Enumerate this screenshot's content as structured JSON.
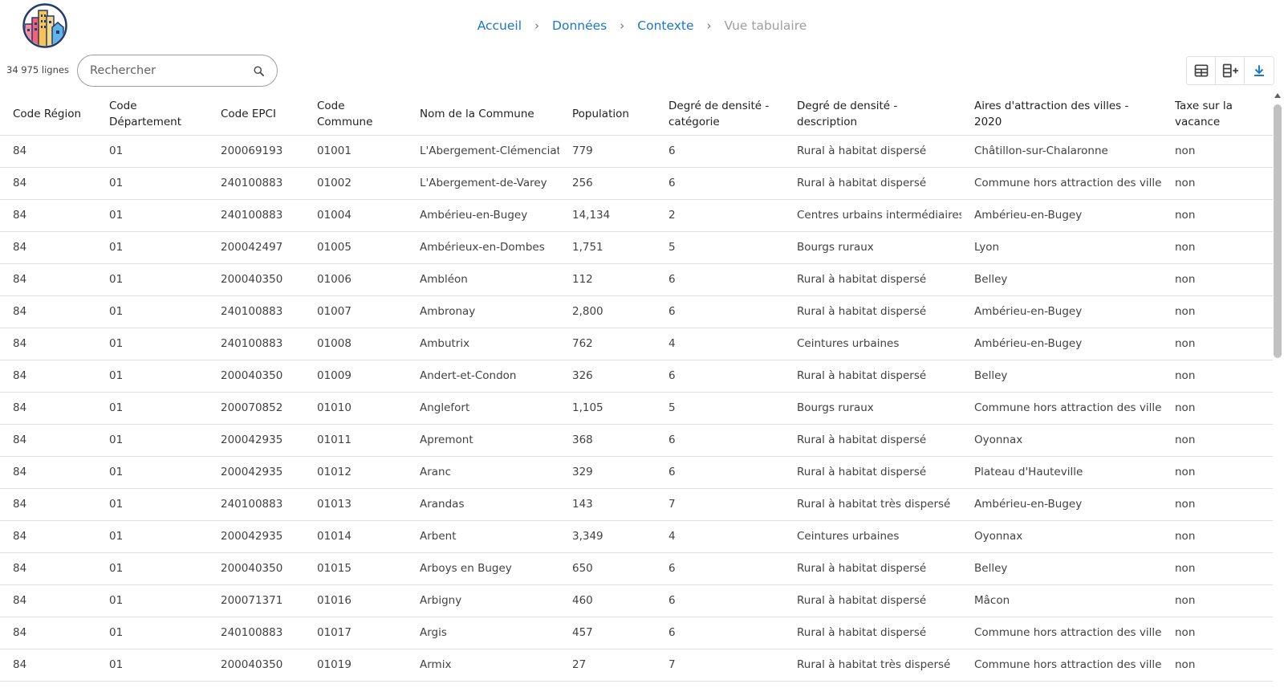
{
  "header": {
    "breadcrumb": [
      {
        "label": "Accueil"
      },
      {
        "label": "Données"
      },
      {
        "label": "Contexte"
      },
      {
        "label": "Vue tabulaire"
      }
    ],
    "separator": "›"
  },
  "toolbar": {
    "row_count": "34 975 lignes",
    "search_placeholder": "Rechercher",
    "search_value": ""
  },
  "icons": {
    "logo": "city-buildings-logo",
    "search": "search-icon",
    "table_view": "table-icon",
    "add_column": "add-column-icon",
    "download": "download-icon"
  },
  "colors": {
    "accent": "#1976d2",
    "muted": "#9e9e9e"
  },
  "table": {
    "columns": [
      "Code Région",
      "Code Département",
      "Code EPCI",
      "Code Commune",
      "Nom de la Commune",
      "Population",
      "Degré de densité - catégorie",
      "Degré de densité - description",
      "Aires d'attraction des villes - 2020",
      "Taxe sur la vacance"
    ],
    "rows": [
      [
        "84",
        "01",
        "200069193",
        "01001",
        "L'Abergement-Clémenciat",
        "779",
        "6",
        "Rural à habitat dispersé",
        "Châtillon-sur-Chalaronne",
        "non"
      ],
      [
        "84",
        "01",
        "240100883",
        "01002",
        "L'Abergement-de-Varey",
        "256",
        "6",
        "Rural à habitat dispersé",
        "Commune hors attraction des villes",
        "non"
      ],
      [
        "84",
        "01",
        "240100883",
        "01004",
        "Ambérieu-en-Bugey",
        "14,134",
        "2",
        "Centres urbains intermédiaires",
        "Ambérieu-en-Bugey",
        "non"
      ],
      [
        "84",
        "01",
        "200042497",
        "01005",
        "Ambérieux-en-Dombes",
        "1,751",
        "5",
        "Bourgs ruraux",
        "Lyon",
        "non"
      ],
      [
        "84",
        "01",
        "200040350",
        "01006",
        "Ambléon",
        "112",
        "6",
        "Rural à habitat dispersé",
        "Belley",
        "non"
      ],
      [
        "84",
        "01",
        "240100883",
        "01007",
        "Ambronay",
        "2,800",
        "6",
        "Rural à habitat dispersé",
        "Ambérieu-en-Bugey",
        "non"
      ],
      [
        "84",
        "01",
        "240100883",
        "01008",
        "Ambutrix",
        "762",
        "4",
        "Ceintures urbaines",
        "Ambérieu-en-Bugey",
        "non"
      ],
      [
        "84",
        "01",
        "200040350",
        "01009",
        "Andert-et-Condon",
        "326",
        "6",
        "Rural à habitat dispersé",
        "Belley",
        "non"
      ],
      [
        "84",
        "01",
        "200070852",
        "01010",
        "Anglefort",
        "1,105",
        "5",
        "Bourgs ruraux",
        "Commune hors attraction des villes",
        "non"
      ],
      [
        "84",
        "01",
        "200042935",
        "01011",
        "Apremont",
        "368",
        "6",
        "Rural à habitat dispersé",
        "Oyonnax",
        "non"
      ],
      [
        "84",
        "01",
        "200042935",
        "01012",
        "Aranc",
        "329",
        "6",
        "Rural à habitat dispersé",
        "Plateau d'Hauteville",
        "non"
      ],
      [
        "84",
        "01",
        "240100883",
        "01013",
        "Arandas",
        "143",
        "7",
        "Rural à habitat très dispersé",
        "Ambérieu-en-Bugey",
        "non"
      ],
      [
        "84",
        "01",
        "200042935",
        "01014",
        "Arbent",
        "3,349",
        "4",
        "Ceintures urbaines",
        "Oyonnax",
        "non"
      ],
      [
        "84",
        "01",
        "200040350",
        "01015",
        "Arboys en Bugey",
        "650",
        "6",
        "Rural à habitat dispersé",
        "Belley",
        "non"
      ],
      [
        "84",
        "01",
        "200071371",
        "01016",
        "Arbigny",
        "460",
        "6",
        "Rural à habitat dispersé",
        "Mâcon",
        "non"
      ],
      [
        "84",
        "01",
        "240100883",
        "01017",
        "Argis",
        "457",
        "6",
        "Rural à habitat dispersé",
        "Commune hors attraction des villes",
        "non"
      ],
      [
        "84",
        "01",
        "200040350",
        "01019",
        "Armix",
        "27",
        "7",
        "Rural à habitat très dispersé",
        "Commune hors attraction des villes",
        "non"
      ]
    ]
  }
}
